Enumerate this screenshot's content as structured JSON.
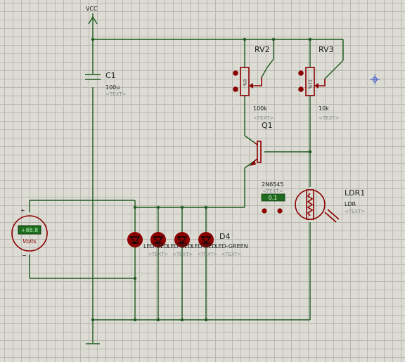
{
  "power": {
    "vcc_label": "VCC"
  },
  "capacitor": {
    "ref": "C1",
    "value": "100u",
    "text": "<TEXT>"
  },
  "rv2": {
    "ref": "RV2",
    "value": "100k",
    "text": "<TEXT>",
    "dial": "0%"
  },
  "rv3": {
    "ref": "RV3",
    "value": "10k",
    "text": "<TEXT>",
    "dial": "11%"
  },
  "transistor": {
    "ref": "Q1",
    "value": "2N6545",
    "text": "<TEXT>",
    "probe": "0.1"
  },
  "ldr": {
    "ref": "LDR1",
    "value": "LDR",
    "text": "<TEXT>"
  },
  "voltmeter": {
    "display": "+88.8",
    "units": "Volts",
    "plus": "+",
    "minus": "−"
  },
  "leds": {
    "ref": "D4",
    "value": "LED-GREEN",
    "overlap_labels": [
      "LED-RED",
      "LED-RED",
      "LED-RED"
    ],
    "texts": [
      "<TEXT>",
      "<TEXT>",
      "<TEXT>",
      "<TEXT>"
    ]
  },
  "colors": {
    "wire": "#1e5a1e",
    "component": "#8b0000",
    "grid": "#b9b9b2",
    "background": "#dcdcd4",
    "meter_display": "#1f6b1f"
  }
}
